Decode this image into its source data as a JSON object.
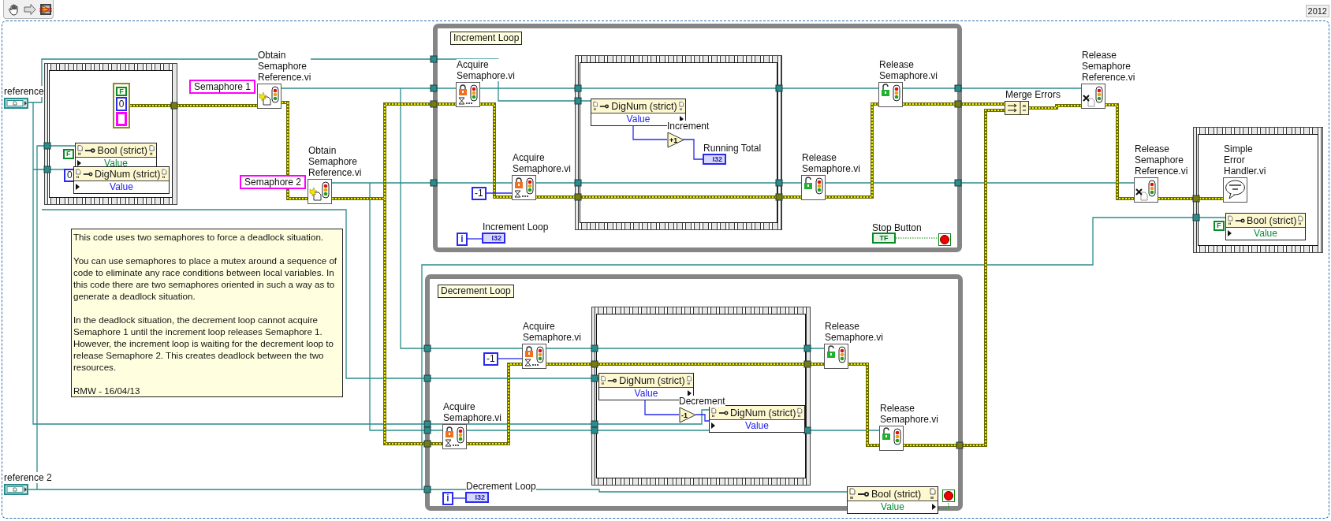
{
  "toolbar": {
    "version": "2012"
  },
  "terminals": [
    {
      "label": "reference"
    },
    {
      "label": "reference 2"
    }
  ],
  "error_cluster": {
    "status": "F",
    "code": "0"
  },
  "constants": [
    {
      "kind": "string",
      "value": "Semaphore 1"
    },
    {
      "kind": "string",
      "value": "Semaphore 2"
    },
    {
      "kind": "boolean",
      "value": "F"
    },
    {
      "kind": "numeric",
      "value": "0"
    },
    {
      "kind": "numeric",
      "value": "-1"
    },
    {
      "kind": "numeric",
      "value": "-1"
    },
    {
      "kind": "boolean",
      "value": "F"
    }
  ],
  "subvis": [
    {
      "kind": "obtain",
      "label": "Obtain Semaphore Reference.vi"
    },
    {
      "kind": "obtain",
      "label": "Obtain Semaphore Reference.vi"
    },
    {
      "kind": "acquire",
      "label": "Acquire Semaphore.vi"
    },
    {
      "kind": "acquire",
      "label": "Acquire Semaphore.vi"
    },
    {
      "kind": "release",
      "label": "Release Semaphore.vi"
    },
    {
      "kind": "release",
      "label": "Release Semaphore.vi"
    },
    {
      "kind": "acquire",
      "label": "Acquire Semaphore.vi"
    },
    {
      "kind": "acquire",
      "label": "Acquire Semaphore.vi"
    },
    {
      "kind": "release",
      "label": "Release Semaphore.vi"
    },
    {
      "kind": "release",
      "label": "Release Semaphore.vi"
    },
    {
      "kind": "release_ref",
      "label": "Release Semaphore Reference.vi"
    },
    {
      "kind": "release_ref",
      "label": "Release Semaphore Reference.vi"
    },
    {
      "kind": "error_handler",
      "label": "Simple Error Handler.vi"
    }
  ],
  "property_nodes": [
    {
      "kind": "bool",
      "class": "Bool (strict)",
      "property": "Value",
      "write": true
    },
    {
      "kind": "dignum",
      "class": "DigNum (strict)",
      "property": "Value",
      "write": true
    },
    {
      "kind": "dignum",
      "class": "DigNum (strict)",
      "property": "Value",
      "write": false
    },
    {
      "kind": "dignum",
      "class": "DigNum (strict)",
      "property": "Value",
      "write": false
    },
    {
      "kind": "dignum",
      "class": "DigNum (strict)",
      "property": "Value",
      "write": true
    },
    {
      "kind": "bool",
      "class": "Bool (strict)",
      "property": "Value",
      "write": true
    },
    {
      "kind": "bool",
      "class": "Bool (strict)",
      "property": "Value",
      "write": false
    }
  ],
  "loops": [
    {
      "label": "Increment Loop",
      "iteration": "i"
    },
    {
      "label": "Decrement Loop",
      "iteration": "i"
    }
  ],
  "primitives": [
    {
      "label": "Increment",
      "symbol": "+1"
    },
    {
      "label": "Decrement",
      "symbol": "-1"
    }
  ],
  "indicators": [
    {
      "label": "Running Total",
      "type": "I32"
    },
    {
      "label": "Increment Loop",
      "type": "I32"
    },
    {
      "label": "Decrement Loop",
      "type": "I32"
    }
  ],
  "stop_control": {
    "label": "Stop Button",
    "type": "TF"
  },
  "merge_errors": {
    "label": "Merge Errors"
  },
  "comment": [
    "This code uses two semaphores to force a deadlock situation.",
    "You can use semaphores to place a mutex around a sequence of code to eliminate any race conditions between local variables. In this code there are two semaphores oriented in such a way as to generate a deadlock situation.",
    "In the deadlock situation, the decrement loop cannot acquire Semaphore 1 until the increment loop releases Semaphore 1. However, the increment loop is waiting for the decrement loop to release Semaphore 2.  This creates deadlock between the two resources.",
    "RMW - 16/04/13"
  ]
}
